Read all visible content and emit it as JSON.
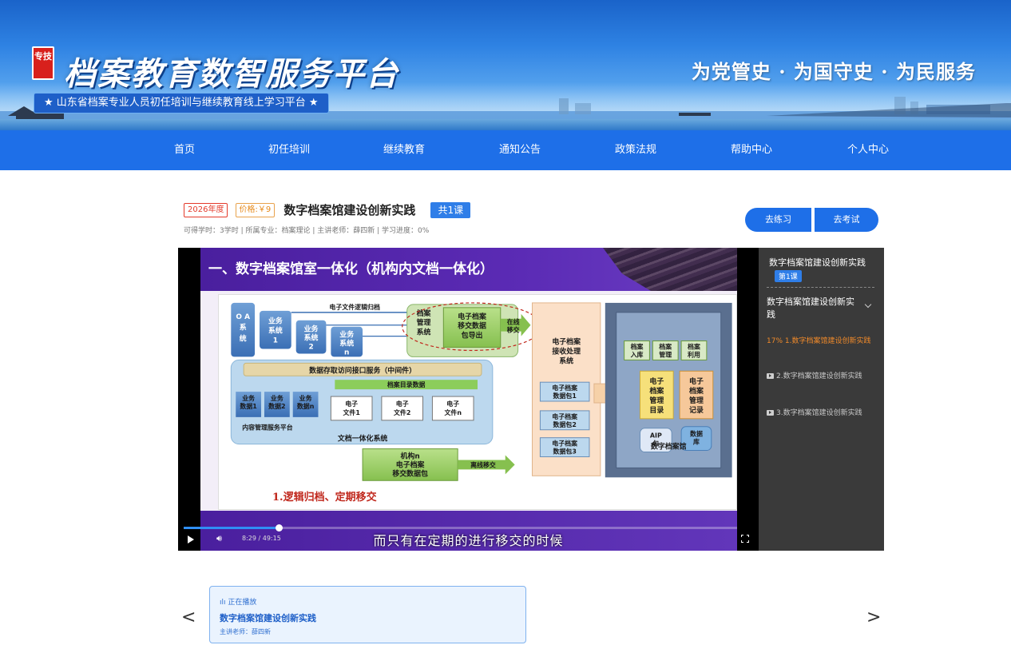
{
  "header": {
    "seal_text": "专技",
    "logo_title": "档案教育数智服务平台",
    "subtitle": "★ 山东省档案专业人员初任培训与继续教育线上学习平台 ★",
    "slogan": "为党管史 · 为国守史 · 为民服务"
  },
  "nav": {
    "items": [
      {
        "label": "首页"
      },
      {
        "label": "初任培训"
      },
      {
        "label": "继续教育"
      },
      {
        "label": "通知公告"
      },
      {
        "label": "政策法规"
      },
      {
        "label": "帮助中心"
      },
      {
        "label": "个人中心"
      }
    ]
  },
  "course": {
    "year_tag": "2026年度",
    "price_tag": "价格:￥9",
    "title": "数字档案馆建设创新实践",
    "lesson_count": "共1课",
    "meta": "可得学时：3学时 | 所属专业：档案理论 | 主讲老师：薛四新 | 学习进度：0%",
    "practice_label": "去练习",
    "exam_label": "去考试"
  },
  "player": {
    "slide_title": "一、数字档案馆室一体化（机构内文档一体化）",
    "caption": "1.逻辑归档、定期移交",
    "subtitle": "而只有在定期的进行移交的时候",
    "time": "8:29 / 49:15",
    "progress": 0.172,
    "diagram": {
      "oa": "O A 系 统",
      "biz1": "业务系统1",
      "biz2": "业务系统2",
      "bizn": "业务系统n",
      "logic_arrow": "电子文件逻辑归档",
      "ams": "档案管理系统",
      "export": "电子档案移交数据包导出",
      "online": "在线移交",
      "middleware": "数据存取访问接口服务（中间件）",
      "catalog": "档案目录数据",
      "bd1": "业务数据1",
      "bd2": "业务数据2",
      "bdn": "业务数据n",
      "ef1": "电子文件1",
      "ef2": "电子文件2",
      "efn": "电子文件n",
      "cms": "内容管理服务平台",
      "docsys": "文档一体化系统",
      "org_pkg": "机构n电子档案移交数据包",
      "offline": "离线移交",
      "receive": "电子档案接收处理系统",
      "pkg1": "电子档案数据包1",
      "pkg2": "电子档案数据包2",
      "pkg3": "电子档案数据包3",
      "in": "档案入库",
      "mgmt": "档案管理",
      "use": "档案利用",
      "catalog2": "电子档案管理目录",
      "record": "电子档案管理记录",
      "aip": "AIP包",
      "db": "数据库",
      "dam": "数字档案馆"
    }
  },
  "playlist": {
    "course_title": "数字档案馆建设创新实践",
    "lesson_badge": "第1课",
    "chapter": "数字档案馆建设创新实践",
    "items": [
      {
        "label": "17%  1.数字档案馆建设创新实践"
      },
      {
        "label": "2.数字档案馆建设创新实践"
      },
      {
        "label": "3.数字档案馆建设创新实践"
      }
    ]
  },
  "carousel": {
    "now_playing": "ılı 正在播放",
    "title": "数字档案馆建设创新实践",
    "teacher": "主讲老师：薛四新",
    "prev": "<",
    "next": ">"
  },
  "colors": {
    "nav_blue": "#1e6fe8",
    "accent_orange": "#f08a2a",
    "slide_purple": "#4a1f9e"
  }
}
